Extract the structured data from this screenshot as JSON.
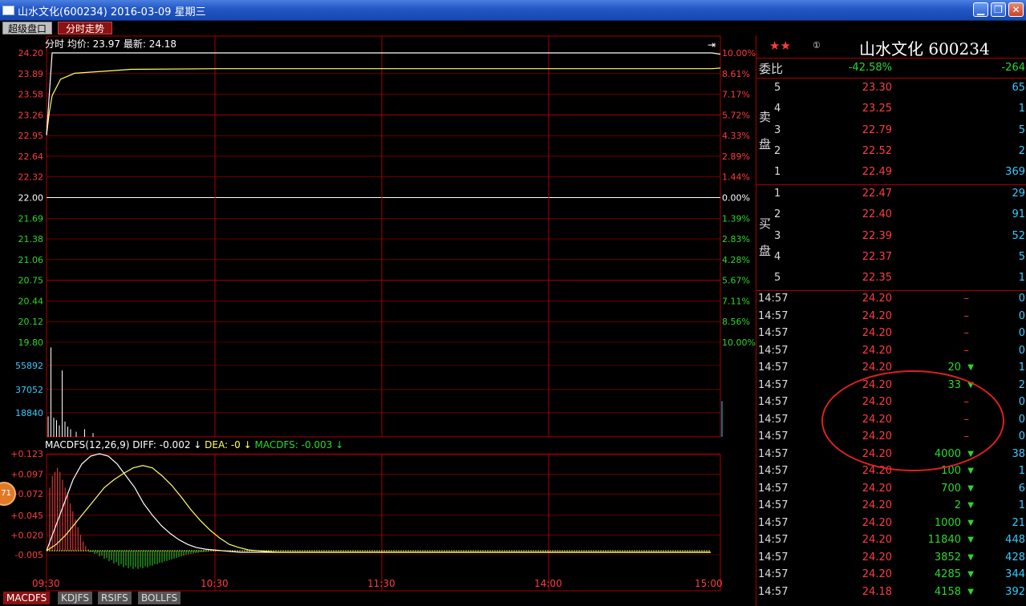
{
  "window": {
    "title": "山水文化(600234) 2016-03-09 星期三",
    "minimize": "▁",
    "restore": "❐",
    "close": "✕"
  },
  "tabs": [
    "超级盘口",
    "分时走势"
  ],
  "price_header": {
    "label": "分时",
    "avg_label": "均价:",
    "avg": "23.97",
    "last_label": "最新:",
    "last": "24.18"
  },
  "price_axis_left": [
    "24.20",
    "23.89",
    "23.58",
    "23.26",
    "22.95",
    "22.64",
    "22.32",
    "22.00",
    "21.69",
    "21.38",
    "21.06",
    "20.75",
    "20.44",
    "20.12",
    "19.80"
  ],
  "price_axis_right": [
    "10.00%",
    "8.61%",
    "7.17%",
    "5.72%",
    "4.33%",
    "2.89%",
    "1.44%",
    "0.00%",
    "1.39%",
    "2.83%",
    "4.28%",
    "5.67%",
    "7.11%",
    "8.56%",
    "10.00%"
  ],
  "volume_axis": [
    "55892",
    "37052",
    "18840"
  ],
  "macd_header": {
    "name": "MACDFS(12,26,9)",
    "diff": "DIFF: -0.002",
    "dea": "DEA: -0",
    "macdfs": "MACDFS: -0.003"
  },
  "macd_axis": [
    "+0.123",
    "+0.097",
    "+0.072",
    "+0.045",
    "+0.020",
    "-0.005"
  ],
  "time_axis": [
    "09:30",
    "10:30",
    "11:30",
    "14:00",
    "15:00"
  ],
  "colors": {
    "up": "#ff3c3c",
    "down": "#2bd82b",
    "grid": "#aa0000",
    "price_line": "#ffffff",
    "avg_line": "#ffff66",
    "volume": "#33ccff"
  },
  "bottom_tabs": [
    "MACDFS",
    "KDJFS",
    "RSIFS",
    "BOLLFS"
  ],
  "badge": "71",
  "stock": {
    "stars": "★★",
    "circle": "①",
    "name": "山水文化 600234"
  },
  "weibi": {
    "label": "委比",
    "pct": "-42.58%",
    "diff": "-264"
  },
  "sell_label": [
    "卖",
    "盘"
  ],
  "buy_label": [
    "买",
    "盘"
  ],
  "sell": [
    {
      "level": "5",
      "price": "23.30",
      "vol": "65"
    },
    {
      "level": "4",
      "price": "23.25",
      "vol": "1"
    },
    {
      "level": "3",
      "price": "22.79",
      "vol": "5"
    },
    {
      "level": "2",
      "price": "22.52",
      "vol": "2"
    },
    {
      "level": "1",
      "price": "22.49",
      "vol": "369"
    }
  ],
  "buy": [
    {
      "level": "1",
      "price": "22.47",
      "vol": "29"
    },
    {
      "level": "2",
      "price": "22.40",
      "vol": "91"
    },
    {
      "level": "3",
      "price": "22.39",
      "vol": "52"
    },
    {
      "level": "4",
      "price": "22.37",
      "vol": "5"
    },
    {
      "level": "5",
      "price": "22.35",
      "vol": "1"
    }
  ],
  "trades": [
    {
      "time": "14:57",
      "price": "24.20",
      "vol": "–",
      "dir": "none",
      "cnt": "0"
    },
    {
      "time": "14:57",
      "price": "24.20",
      "vol": "–",
      "dir": "none",
      "cnt": "0"
    },
    {
      "time": "14:57",
      "price": "24.20",
      "vol": "–",
      "dir": "none",
      "cnt": "0"
    },
    {
      "time": "14:57",
      "price": "24.20",
      "vol": "–",
      "dir": "none",
      "cnt": "0"
    },
    {
      "time": "14:57",
      "price": "24.20",
      "vol": "20",
      "dir": "down",
      "cnt": "1"
    },
    {
      "time": "14:57",
      "price": "24.20",
      "vol": "33",
      "dir": "down",
      "cnt": "2"
    },
    {
      "time": "14:57",
      "price": "24.20",
      "vol": "–",
      "dir": "none",
      "cnt": "0"
    },
    {
      "time": "14:57",
      "price": "24.20",
      "vol": "–",
      "dir": "none",
      "cnt": "0"
    },
    {
      "time": "14:57",
      "price": "24.20",
      "vol": "–",
      "dir": "none",
      "cnt": "0"
    },
    {
      "time": "14:57",
      "price": "24.20",
      "vol": "4000",
      "dir": "down",
      "cnt": "38"
    },
    {
      "time": "14:57",
      "price": "24.20",
      "vol": "100",
      "dir": "down",
      "cnt": "1"
    },
    {
      "time": "14:57",
      "price": "24.20",
      "vol": "700",
      "dir": "down",
      "cnt": "6"
    },
    {
      "time": "14:57",
      "price": "24.20",
      "vol": "2",
      "dir": "down",
      "cnt": "1"
    },
    {
      "time": "14:57",
      "price": "24.20",
      "vol": "1000",
      "dir": "down",
      "cnt": "21"
    },
    {
      "time": "14:57",
      "price": "24.20",
      "vol": "11840",
      "dir": "down",
      "cnt": "448"
    },
    {
      "time": "14:57",
      "price": "24.20",
      "vol": "3852",
      "dir": "down",
      "cnt": "428"
    },
    {
      "time": "14:57",
      "price": "24.20",
      "vol": "4285",
      "dir": "down",
      "cnt": "344"
    },
    {
      "time": "14:57",
      "price": "24.18",
      "vol": "4158",
      "dir": "down",
      "cnt": "392"
    }
  ],
  "chart_data": {
    "type": "line",
    "xlabel": "",
    "ylabel": "",
    "price_range": [
      19.8,
      24.2
    ],
    "prev_close": 22.0,
    "price_series": {
      "x": [
        "09:30",
        "09:31",
        "09:32",
        "09:33",
        "09:35",
        "09:40",
        "10:00",
        "10:30",
        "11:30",
        "14:00",
        "14:57",
        "15:00"
      ],
      "values": [
        22.95,
        23.58,
        24.2,
        24.2,
        24.2,
        24.2,
        24.2,
        24.2,
        24.2,
        24.2,
        24.2,
        24.18
      ]
    },
    "avg_series": {
      "x": [
        "09:30",
        "09:31",
        "09:32",
        "09:35",
        "09:40",
        "09:50",
        "10:00",
        "10:30",
        "11:30",
        "14:00",
        "14:57",
        "15:00"
      ],
      "values": [
        22.95,
        23.3,
        23.55,
        23.8,
        23.89,
        23.92,
        23.95,
        23.96,
        23.96,
        23.96,
        23.96,
        23.97
      ]
    },
    "volume_range": [
      0,
      74000
    ],
    "volume_bars": [
      {
        "t": 0,
        "v": 16000
      },
      {
        "t": 1,
        "v": 70000
      },
      {
        "t": 2,
        "v": 15000
      },
      {
        "t": 3,
        "v": 13000
      },
      {
        "t": 4,
        "v": 9000
      },
      {
        "t": 5,
        "v": 52000
      },
      {
        "t": 6,
        "v": 12000
      },
      {
        "t": 7,
        "v": 8000
      },
      {
        "t": 8,
        "v": 6000
      },
      {
        "t": 10,
        "v": 4000
      },
      {
        "t": 13,
        "v": 6000
      },
      {
        "t": 16,
        "v": 3000
      },
      {
        "t": 240,
        "v": 28000
      }
    ],
    "macd_range": [
      -0.03,
      0.123
    ],
    "diff_series": [
      0,
      0.03,
      0.06,
      0.09,
      0.11,
      0.12,
      0.123,
      0.12,
      0.11,
      0.095,
      0.08,
      0.06,
      0.045,
      0.032,
      0.022,
      0.014,
      0.008,
      0.004,
      0.002,
      0.001,
      0,
      -0.001,
      -0.002
    ],
    "dea_series": [
      0,
      0.008,
      0.02,
      0.035,
      0.05,
      0.065,
      0.08,
      0.09,
      0.098,
      0.105,
      0.108,
      0.105,
      0.095,
      0.083,
      0.068,
      0.052,
      0.038,
      0.026,
      0.016,
      0.008,
      0.004,
      0.001,
      0,
      -0.001,
      -0.002
    ],
    "macd_bars_up": [
      0.08,
      0.095,
      0.1,
      0.105,
      0.1,
      0.09,
      0.08,
      0.07,
      0.06,
      0.05,
      0.04,
      0.03,
      0.02,
      0.012,
      0.006,
      0.002
    ],
    "macd_bars_down": [
      0.002,
      0.004,
      0.007,
      0.01,
      0.013,
      0.016,
      0.019,
      0.021,
      0.022,
      0.023,
      0.023,
      0.022,
      0.021,
      0.019,
      0.017,
      0.015,
      0.013,
      0.011,
      0.009,
      0.007,
      0.005,
      0.004,
      0.003,
      0.002,
      0.001
    ]
  }
}
